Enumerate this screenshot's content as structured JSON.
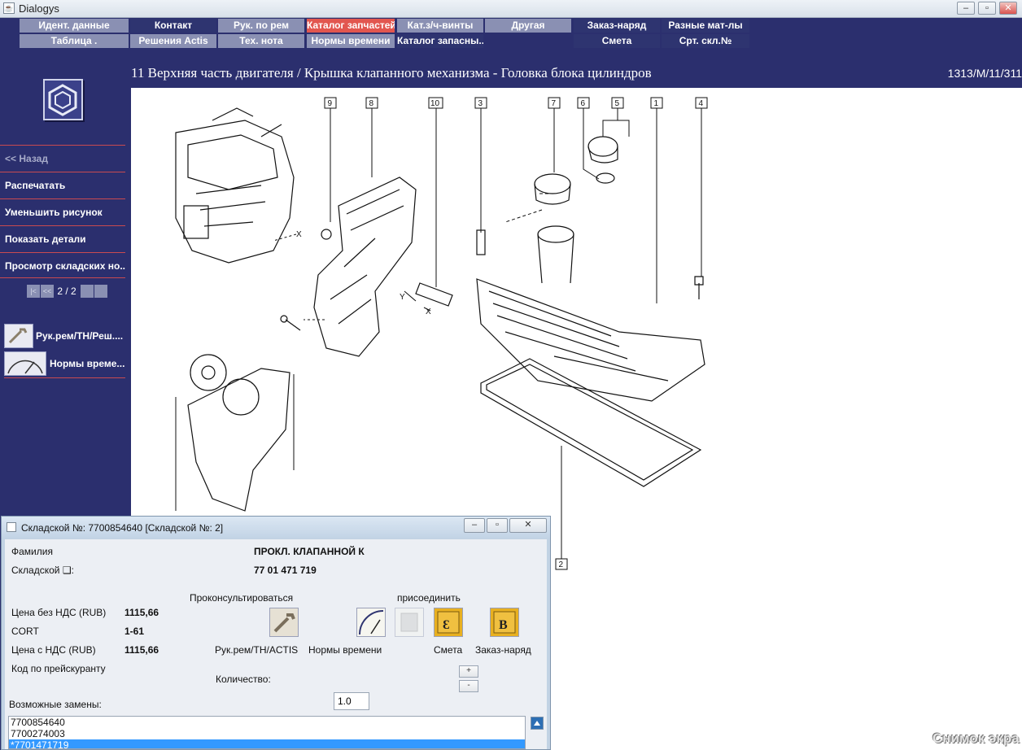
{
  "window": {
    "title": "Dialogys"
  },
  "menu": {
    "row1": [
      {
        "label": "Идент. данные",
        "style": "gray"
      },
      {
        "label": "Контакт",
        "style": "dark"
      },
      {
        "label": "Рук. по рем",
        "style": "gray"
      },
      {
        "label": "Каталог запчастей",
        "style": "red"
      },
      {
        "label": "Кат.з/ч-винты",
        "style": "gray"
      },
      {
        "label": "Другая",
        "style": "gray"
      },
      {
        "label": "Заказ-наряд",
        "style": "dark"
      },
      {
        "label": "Разные мат-лы",
        "style": "dark"
      }
    ],
    "row2": [
      {
        "label": "Таблица .",
        "style": "gray"
      },
      {
        "label": "Решения Actis",
        "style": "gray"
      },
      {
        "label": "Тех. нота",
        "style": "gray"
      },
      {
        "label": "Нормы времени",
        "style": "gray"
      },
      {
        "label": "Каталог запасны...",
        "style": "dark"
      },
      {
        "label": "Смета",
        "style": "dark"
      },
      {
        "label": "Срт. скл.№",
        "style": "dark"
      }
    ]
  },
  "sidebar": {
    "back": "<< Назад",
    "items": [
      "Распечатать",
      "Уменьшить рисунок",
      "Показать детали",
      "Просмотр складских но..."
    ],
    "pager": "2 / 2",
    "links": [
      "Рук.рем/ТН/Реш....",
      "Нормы време..."
    ]
  },
  "heading": {
    "title": "11 Верхняя часть двигателя / Крышка клапанного механизма - Головка блока цилиндров",
    "ref": "1313/M/11/311"
  },
  "drawing": {
    "callouts": [
      "9",
      "8",
      "10",
      "3",
      "7",
      "6",
      "5",
      "1",
      "4",
      "2"
    ],
    "axis_labels": [
      "X",
      "Y",
      "X"
    ]
  },
  "dialog": {
    "title": "Складской №: 7700854640 [Складской №: 2]",
    "family_label": "Фамилия",
    "family_value": "ПРОКЛ. КЛАПАННОЙ К",
    "stock_label": "Складской ❑:",
    "stock_value": "77 01 471 719",
    "consult_label": "Проконсультироваться",
    "attach_label": "присоединить",
    "price_excl_label": "Цена без НДС (RUB)",
    "price_excl_value": "1115,66",
    "cort_label": "CORT",
    "cort_value": "1-61",
    "price_incl_label": "Цена с НДС (RUB)",
    "price_incl_value": "1115,66",
    "price_code_label": "Код по прейскуранту",
    "btn_repair": "Рук.рем/ТН/ACTIS",
    "btn_times": "Нормы времени",
    "btn_estimate": "Смета",
    "btn_order": "Заказ-наряд",
    "qty_label": "Количество:",
    "qty_value": "1.0",
    "plus": "+",
    "minus": "-",
    "subs_label": "Возможные замены:",
    "substitutes": [
      "7700854640",
      "7700274003",
      "*7701471719"
    ]
  },
  "watermark": "Снимок экра"
}
